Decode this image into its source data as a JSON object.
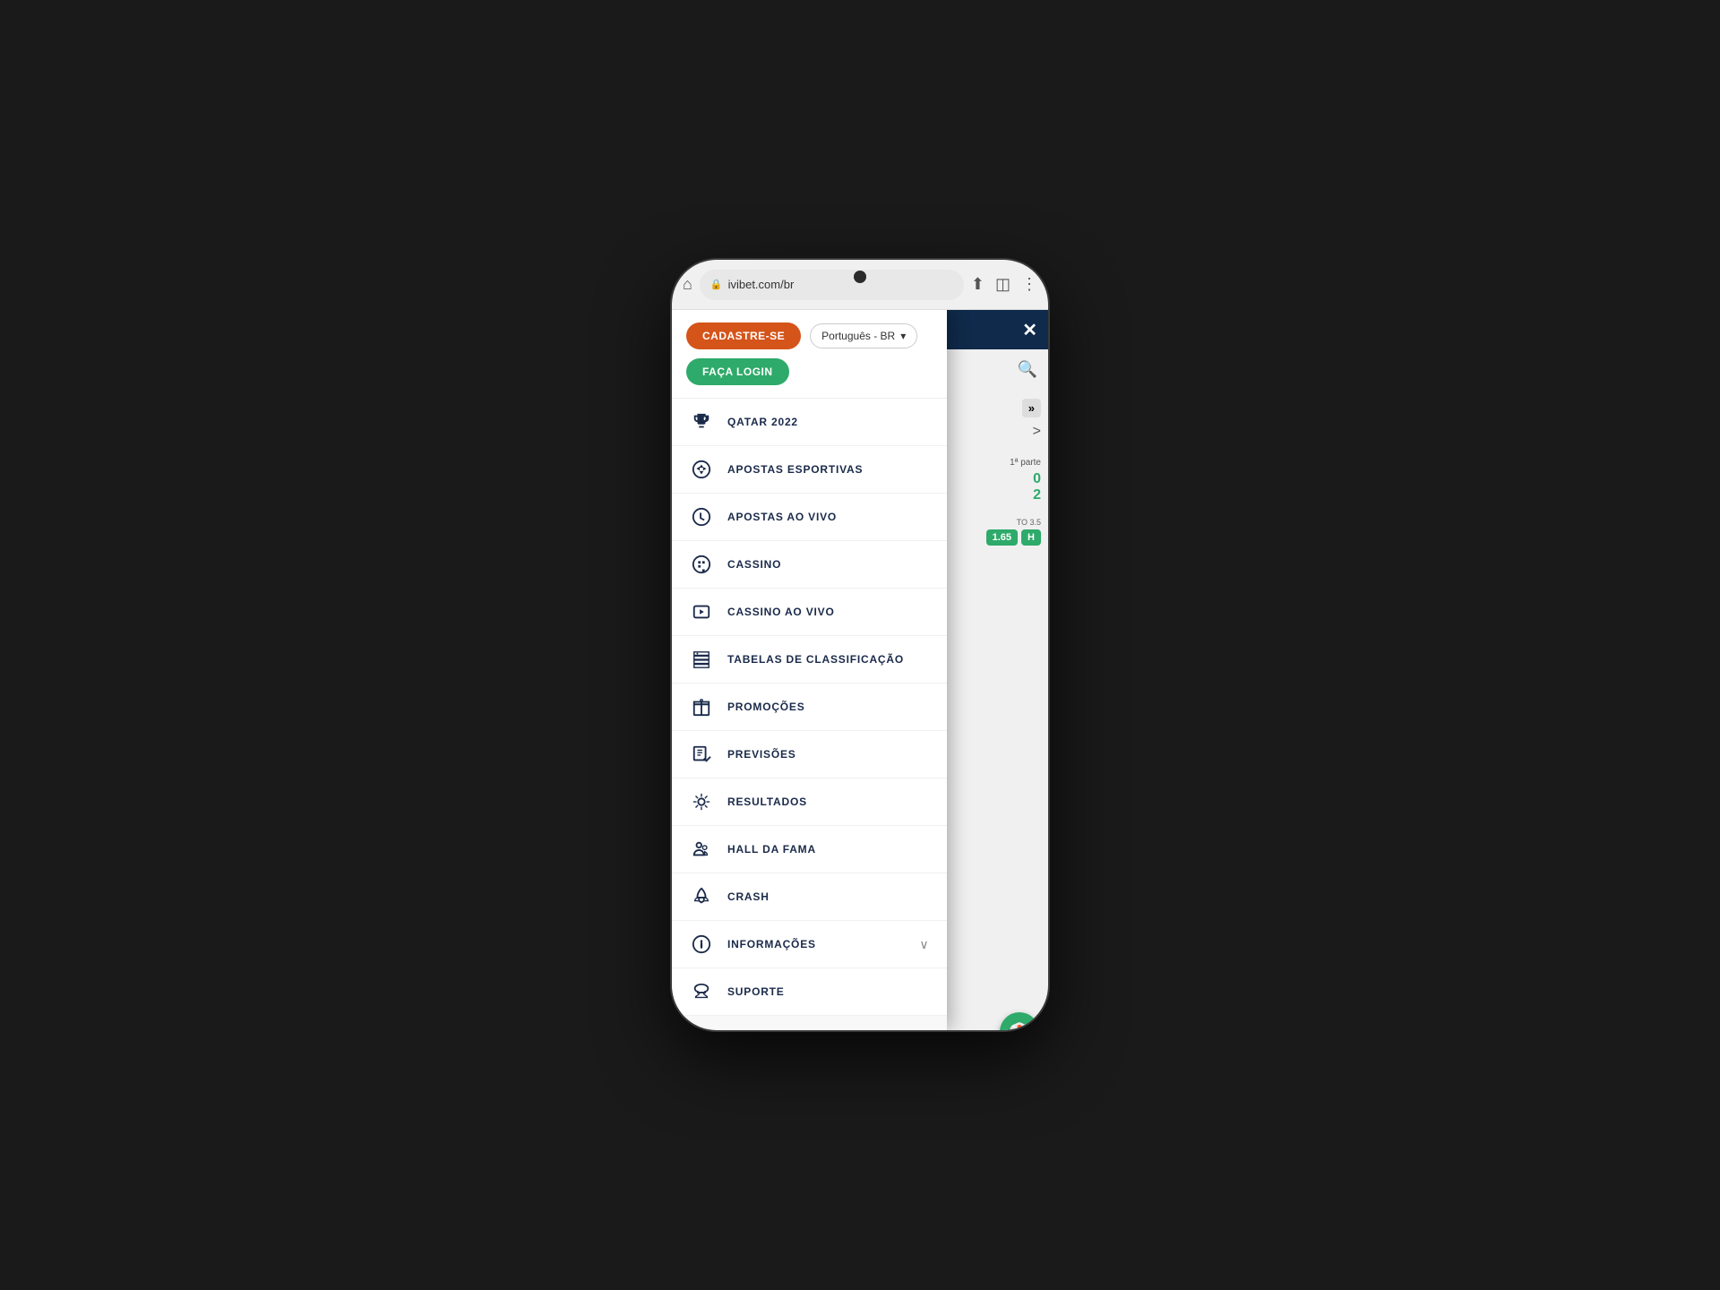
{
  "browser": {
    "url": "ivibet.com/br",
    "home_icon": "⌂",
    "share_icon": "⬆",
    "reader_icon": "◫",
    "more_icon": "⋮"
  },
  "header": {
    "register_label": "CADASTRE-SE",
    "close_label": "✕"
  },
  "menu": {
    "register_btn": "CADASTRE-SE",
    "login_btn": "FAÇA LOGIN",
    "language": "Português - BR",
    "language_chevron": "▾",
    "items": [
      {
        "id": "qatar2022",
        "label": "QATAR 2022",
        "icon": "trophy"
      },
      {
        "id": "apostas-esportivas",
        "label": "APOSTAS ESPORTIVAS",
        "icon": "soccer"
      },
      {
        "id": "apostas-ao-vivo",
        "label": "APOSTAS AO VIVO",
        "icon": "clock-sport"
      },
      {
        "id": "cassino",
        "label": "CASSINO",
        "icon": "casino"
      },
      {
        "id": "cassino-ao-vivo",
        "label": "CASSINO AO VIVO",
        "icon": "casino-live"
      },
      {
        "id": "tabelas",
        "label": "TABELAS DE CLASSIFICAÇÃO",
        "icon": "table"
      },
      {
        "id": "promocoes",
        "label": "PROMOÇÕES",
        "icon": "gift"
      },
      {
        "id": "previsoes",
        "label": "PREVISÕES",
        "icon": "predictions"
      },
      {
        "id": "resultados",
        "label": "RESULTADOS",
        "icon": "results"
      },
      {
        "id": "hall-da-fama",
        "label": "HALL DA FAMA",
        "icon": "fame"
      },
      {
        "id": "crash",
        "label": "CRASH",
        "icon": "rocket"
      },
      {
        "id": "informacoes",
        "label": "INFORMAÇÕES",
        "icon": "info",
        "has_chevron": true,
        "chevron": "∨"
      },
      {
        "id": "suporte",
        "label": "SUPORTE",
        "icon": "support"
      }
    ]
  },
  "dots": {
    "active_color": "#e8a030",
    "inactive_color": "#666"
  },
  "right_panel": {
    "search_icon": "🔍",
    "arrow": "»",
    "nav_chevron": ">",
    "match_time": "1ª parte",
    "score1": "0",
    "score2": "2",
    "odds_label": "TO 3.5",
    "odds_value": "1.65",
    "odds_h": "H"
  },
  "colors": {
    "register_orange": "#d4541a",
    "login_green": "#2eaa6a",
    "menu_text": "#1a2a4a",
    "active_dot": "#e8a030",
    "inactive_dot": "#888888"
  }
}
